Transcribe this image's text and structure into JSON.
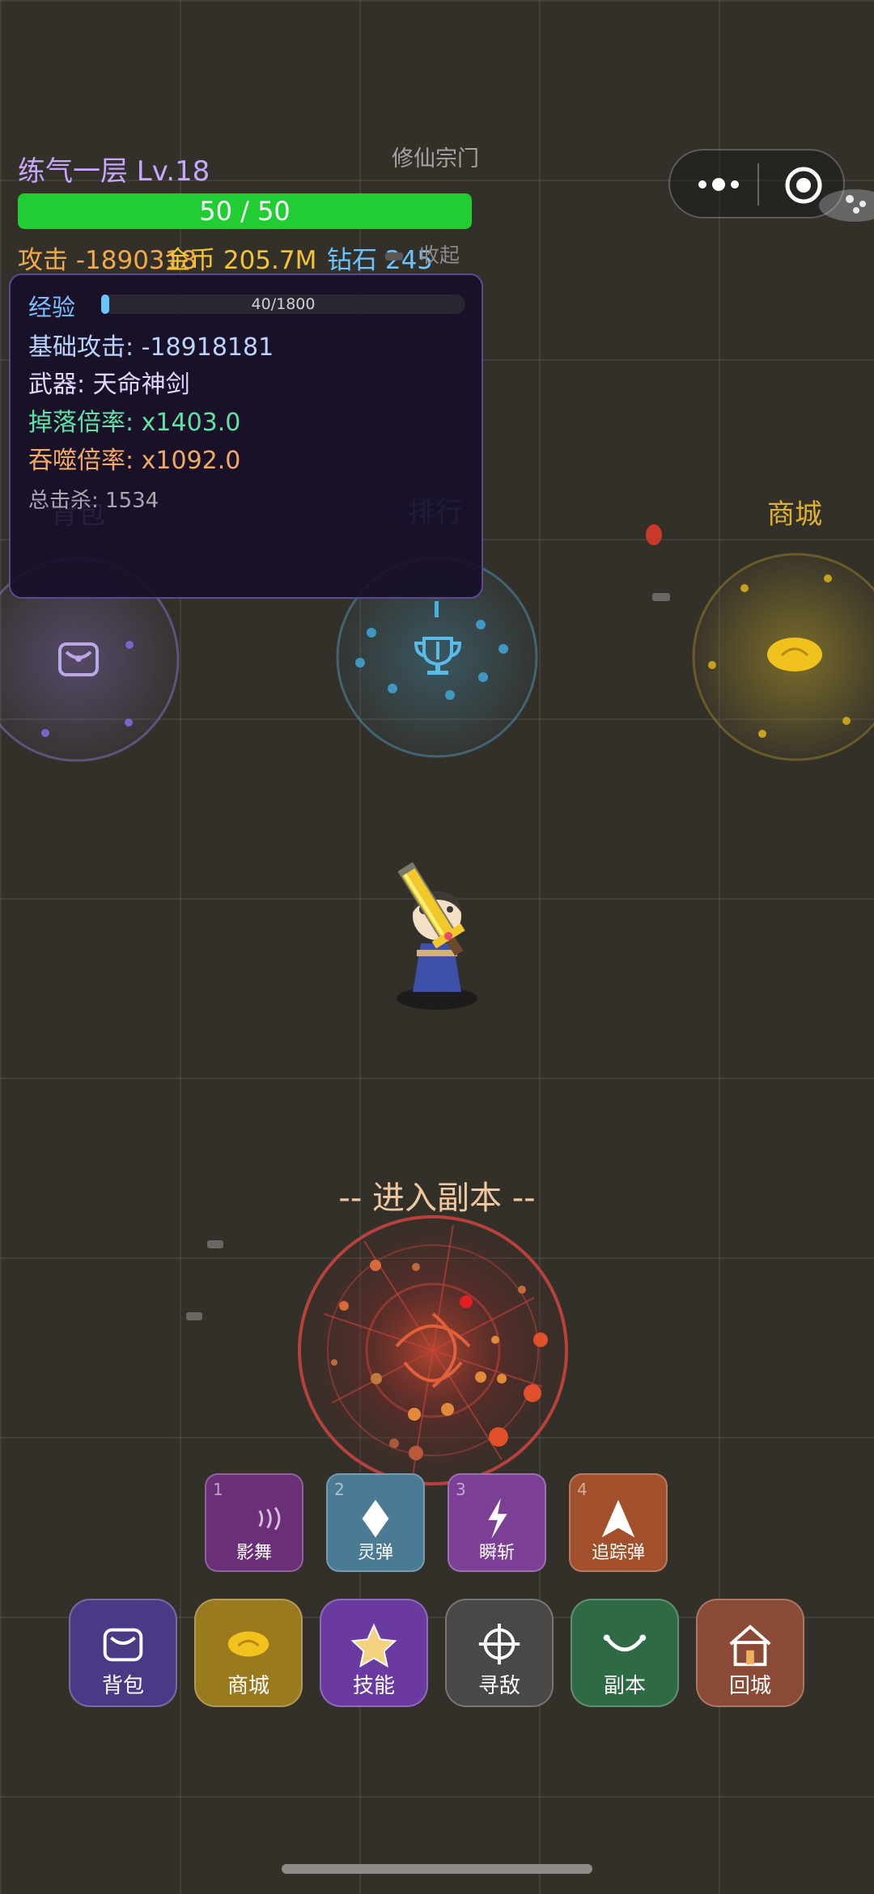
{
  "hud": {
    "level": "练气一层 Lv.18",
    "sect": "修仙宗门",
    "hp_text": "50 / 50",
    "attack": "攻击 -1890318",
    "gold": "金币 205.7M",
    "diamond": "钻石 245",
    "collapse": "收起"
  },
  "panel": {
    "exp_label": "经验",
    "exp_text": "40/1800",
    "exp_progress": 0.022,
    "base_attack": "基础攻击: -18918181",
    "weapon": "武器: 天命神剑",
    "drop_rate": "掉落倍率: x1403.0",
    "devour_rate": "吞噬倍率: x1092.0",
    "total_kills": "总击杀: 1534"
  },
  "portals": {
    "bag": "背包",
    "rank": "排行",
    "shop": "商城",
    "dungeon": "-- 进入副本 --"
  },
  "skills": [
    {
      "num": "1",
      "label": "影舞",
      "color": "#6a2f78",
      "icon": "wave-icon"
    },
    {
      "num": "2",
      "label": "灵弹",
      "color": "#4b7a95",
      "icon": "diamond-icon"
    },
    {
      "num": "3",
      "label": "瞬斩",
      "color": "#7b3f96",
      "icon": "lightning-icon"
    },
    {
      "num": "4",
      "label": "追踪弹",
      "color": "#a24f2b",
      "icon": "arrow-icon"
    }
  ],
  "menu": [
    {
      "label": "背包",
      "color": "#4a3a86",
      "icon": "bag-icon"
    },
    {
      "label": "商城",
      "color": "#9a7a1e",
      "icon": "coin-icon"
    },
    {
      "label": "技能",
      "color": "#6a3aa0",
      "icon": "star-icon"
    },
    {
      "label": "寻敌",
      "color": "#4a4846",
      "icon": "crosshair-icon"
    },
    {
      "label": "副本",
      "color": "#2e6a44",
      "icon": "portal-icon"
    },
    {
      "label": "回城",
      "color": "#8a4a36",
      "icon": "home-icon"
    }
  ]
}
